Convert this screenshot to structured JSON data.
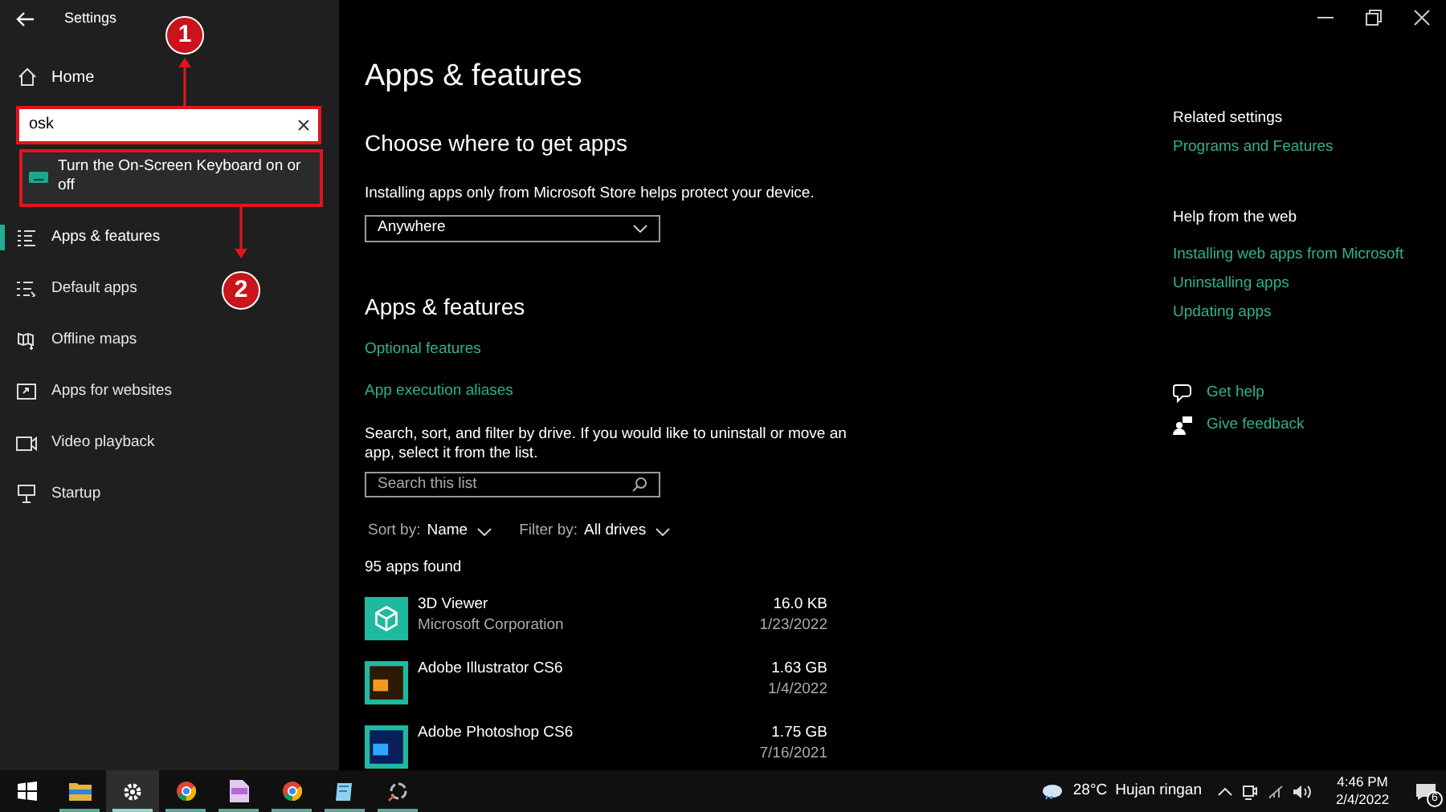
{
  "window": {
    "title": "Settings"
  },
  "sidebar": {
    "home": "Home",
    "search": {
      "value": "osk"
    },
    "search_results": [
      {
        "label": "Turn the On-Screen Keyboard on or off"
      }
    ],
    "items": [
      {
        "label": "Apps & features",
        "kind": "list",
        "selected": true
      },
      {
        "label": "Default apps",
        "kind": "default",
        "selected": false
      },
      {
        "label": "Offline maps",
        "kind": "map",
        "selected": false
      },
      {
        "label": "Apps for websites",
        "kind": "web",
        "selected": false
      },
      {
        "label": "Video playback",
        "kind": "video",
        "selected": false
      },
      {
        "label": "Startup",
        "kind": "startup",
        "selected": false
      }
    ]
  },
  "annotations": [
    {
      "label": "1"
    },
    {
      "label": "2"
    }
  ],
  "main": {
    "title": "Apps & features",
    "section1": {
      "heading": "Choose where to get apps",
      "description": "Installing apps only from Microsoft Store helps protect your device.",
      "dropdown": "Anywhere"
    },
    "section2": {
      "heading": "Apps & features",
      "links": [
        "Optional features",
        "App execution aliases"
      ],
      "description": "Search, sort, and filter by drive. If you would like to uninstall or move an app, select it from the list.",
      "search": {
        "placeholder": "Search this list"
      },
      "sort": {
        "label": "Sort by:",
        "value": "Name"
      },
      "filter": {
        "label": "Filter by:",
        "value": "All drives"
      },
      "count": "95 apps found",
      "apps": [
        {
          "name": "3D Viewer",
          "publisher": "Microsoft Corporation",
          "size": "16.0 KB",
          "date": "1/23/2022",
          "kind": "viewer"
        },
        {
          "name": "Adobe Illustrator CS6",
          "size": "1.63 GB",
          "date": "1/4/2022",
          "kind": "illustrator"
        },
        {
          "name": "Adobe Photoshop CS6",
          "size": "1.75 GB",
          "date": "7/16/2021",
          "kind": "photoshop"
        }
      ]
    }
  },
  "related": {
    "heading": "Related settings",
    "links": [
      "Programs and Features"
    ]
  },
  "help": {
    "heading": "Help from the web",
    "links": [
      "Installing web apps from Microsoft",
      "Uninstalling apps",
      "Updating apps"
    ]
  },
  "support": [
    {
      "label": "Get help",
      "kind": "help"
    },
    {
      "label": "Give feedback",
      "kind": "feedback"
    }
  ],
  "taskbar": {
    "items": [
      {
        "kind": "start",
        "selected": false
      },
      {
        "kind": "explorer",
        "selected": false
      },
      {
        "kind": "settings",
        "selected": true
      },
      {
        "kind": "chrome",
        "selected": false
      },
      {
        "kind": "csv",
        "selected": false
      },
      {
        "kind": "chrome",
        "selected": false
      },
      {
        "kind": "notepad",
        "selected": false
      },
      {
        "kind": "capture",
        "selected": false
      }
    ],
    "weather": {
      "temperature": "28°C",
      "condition": "Hujan ringan"
    },
    "time": "4:46 PM",
    "date": "2/4/2022",
    "notifications": "6"
  }
}
